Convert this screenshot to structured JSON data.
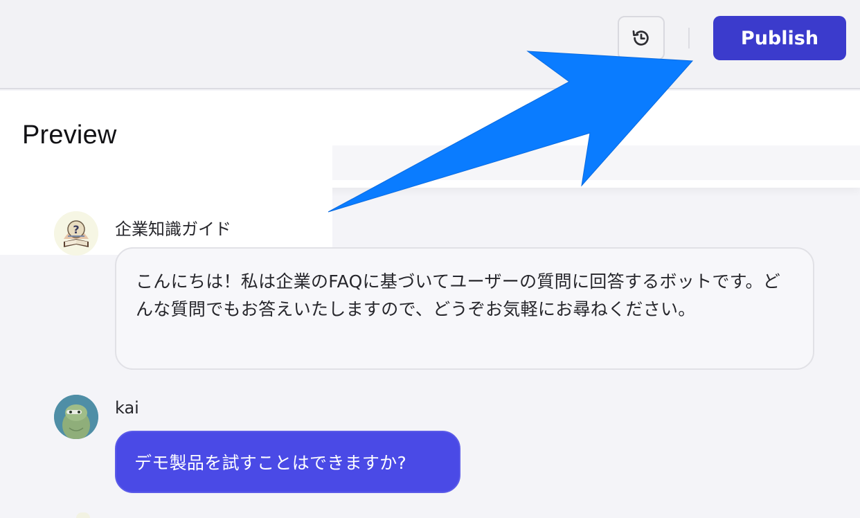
{
  "toolbar": {
    "history_icon": "history-icon",
    "publish_label": "Publish",
    "publish_color": "#3b3bcc"
  },
  "preview": {
    "title": "Preview"
  },
  "chat": {
    "messages": [
      {
        "sender": "企業知識ガイド",
        "role": "bot",
        "avatar_icon": "book-question-avatar",
        "text": "こんにちは！私は企業のFAQに基づいてユーザーの質問に回答するボットです。どんな質問でもお答えいたしますので、どうぞお気軽にお尋ねください。"
      },
      {
        "sender": "kai",
        "role": "user",
        "avatar_icon": "user-avatar",
        "text": "デモ製品を試すことはできますか?",
        "bubble_color": "#4a4ae6"
      }
    ]
  },
  "annotation": {
    "arrow_color": "#0a7cff"
  }
}
